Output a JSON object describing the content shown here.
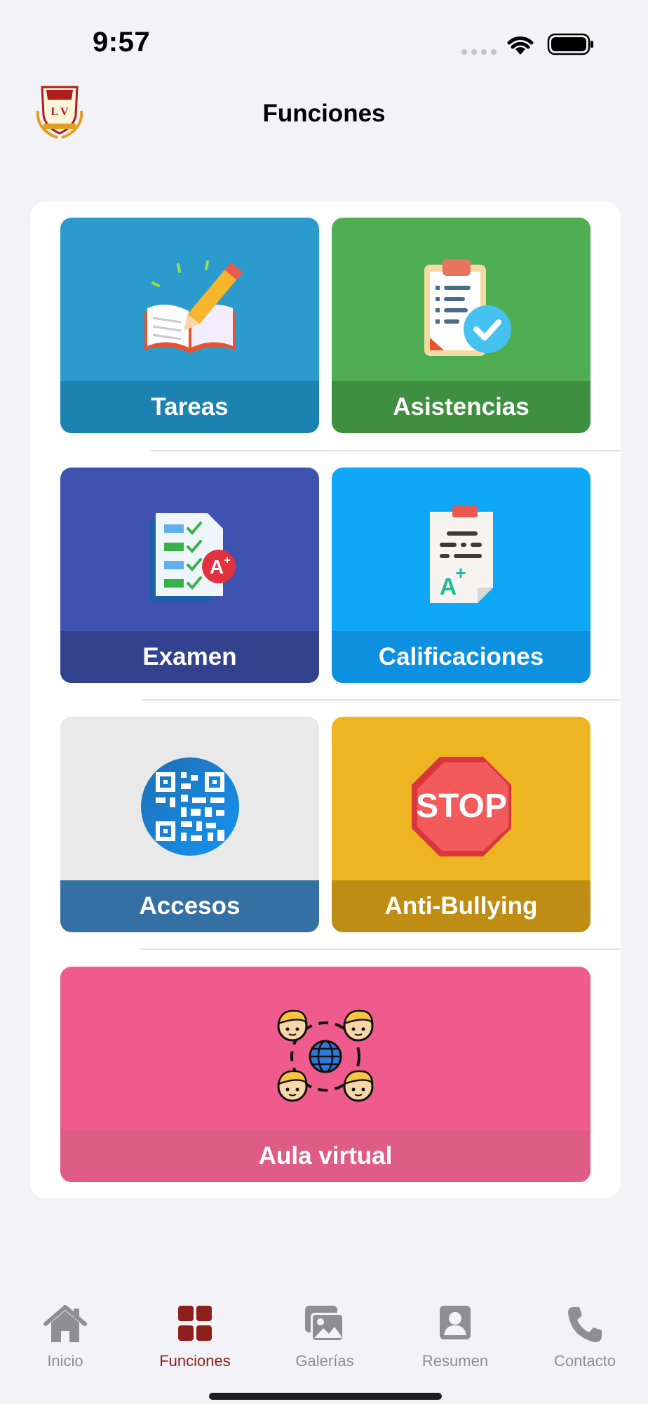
{
  "status_bar": {
    "time": "9:57"
  },
  "header": {
    "title": "Funciones",
    "logo_text": "COLEGIO L V"
  },
  "tiles": [
    {
      "label": "Tareas",
      "icon": "book-pencil-icon",
      "color": "#2b9bcd",
      "band_color": "#1c82b2"
    },
    {
      "label": "Asistencias",
      "icon": "clipboard-check-icon",
      "color": "#4fad52",
      "band_color": "#3f8f40"
    },
    {
      "label": "Examen",
      "icon": "exam-checklist-icon",
      "color": "#3f52b0",
      "band_color": "#33428f"
    },
    {
      "label": "Calificaciones",
      "icon": "grade-report-icon",
      "color": "#0ea8f7",
      "band_color": "#0c90df"
    },
    {
      "label": "Accesos",
      "icon": "qr-code-icon",
      "color": "#e9e9ea",
      "band_color": "#3570a4"
    },
    {
      "label": "Anti-Bullying",
      "icon": "stop-sign-icon",
      "color": "#efb422",
      "band_color": "#c08d14"
    },
    {
      "label": "Aula virtual",
      "icon": "virtual-classroom-icon",
      "color": "#ef5b8d",
      "band_color": "#df5c87"
    }
  ],
  "tabs": [
    {
      "label": "Inicio",
      "icon": "home-icon",
      "active": false
    },
    {
      "label": "Funciones",
      "icon": "grid-icon",
      "active": true
    },
    {
      "label": "Galerías",
      "icon": "gallery-icon",
      "active": false
    },
    {
      "label": "Resumen",
      "icon": "profile-icon",
      "active": false
    },
    {
      "label": "Contacto",
      "icon": "phone-icon",
      "active": false
    }
  ],
  "colors": {
    "accent": "#8f1f1a",
    "inactive": "#8e8e93",
    "background": "#f2f2f7"
  }
}
